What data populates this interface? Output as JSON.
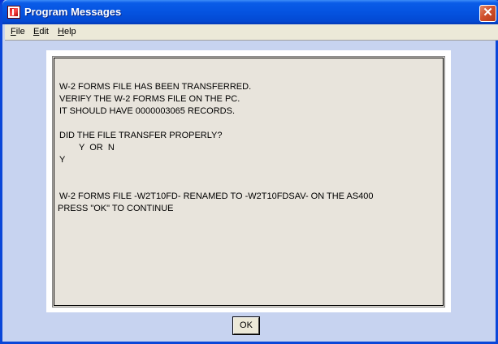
{
  "window": {
    "title": "Program Messages",
    "close_label": "✕"
  },
  "menubar": {
    "items": [
      {
        "first": "F",
        "rest": "ile"
      },
      {
        "first": "E",
        "rest": "dit"
      },
      {
        "first": "H",
        "rest": "elp"
      }
    ]
  },
  "message": {
    "lines": [
      "W-2 FORMS FILE HAS BEEN TRANSFERRED.",
      "VERIFY THE W-2 FORMS FILE ON THE PC.",
      "IT SHOULD HAVE 0000003065 RECORDS.",
      "DID THE FILE TRANSFER PROPERLY?",
      "Y  OR  N",
      "Y",
      "W-2 FORMS FILE -W2T10FD- RENAMED TO -W2T10FDSAV- ON THE AS400",
      "PRESS \"OK\" TO CONTINUE"
    ]
  },
  "buttons": {
    "ok_label": "OK"
  }
}
